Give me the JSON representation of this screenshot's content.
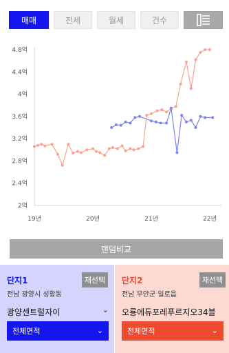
{
  "tabs": [
    {
      "label": "매매",
      "active": true
    },
    {
      "label": "전세",
      "active": false
    },
    {
      "label": "월세",
      "active": false
    },
    {
      "label": "건수",
      "active": false
    }
  ],
  "list_button_icon": "list-view-icon",
  "chart_data": {
    "type": "line",
    "ylim": [
      2.0,
      4.8
    ],
    "y_ticks": [
      "2억",
      "2.4억",
      "2.8억",
      "3.2억",
      "3.6억",
      "4억",
      "4.4억",
      "4.8억"
    ],
    "x_ticks": [
      "19년",
      "20년",
      "21년",
      "22년"
    ],
    "x_range": [
      2019.0,
      2022.2
    ],
    "grid": false,
    "series": [
      {
        "color": "#f8a493",
        "x": [
          2019.0,
          2019.06,
          2019.12,
          2019.18,
          2019.3,
          2019.4,
          2019.48,
          2019.58,
          2019.66,
          2019.74,
          2019.8,
          2019.9,
          2020.0,
          2020.06,
          2020.12,
          2020.2,
          2020.28,
          2020.34,
          2020.42,
          2020.5,
          2020.56,
          2020.64,
          2020.7,
          2020.78,
          2020.86,
          2020.92,
          2021.0,
          2021.1,
          2021.18,
          2021.26,
          2021.34,
          2021.42,
          2021.5,
          2021.6,
          2021.68,
          2021.76,
          2021.84,
          2021.92,
          2022.0
        ],
        "y": [
          3.06,
          3.08,
          3.1,
          3.07,
          3.1,
          2.92,
          2.72,
          3.1,
          2.94,
          2.97,
          2.95,
          3.0,
          3.02,
          2.97,
          2.95,
          2.9,
          3.02,
          3.04,
          3.02,
          3.07,
          2.98,
          3.02,
          3.0,
          3.02,
          3.06,
          3.62,
          3.65,
          3.7,
          3.72,
          3.68,
          3.74,
          3.78,
          4.18,
          4.58,
          4.1,
          4.62,
          4.75,
          4.8,
          4.8
        ]
      },
      {
        "color": "#7d82ee",
        "x": [
          2020.32,
          2020.4,
          2020.48,
          2020.56,
          2020.64,
          2020.72,
          2020.8,
          2021.0,
          2021.08,
          2021.16,
          2021.26,
          2021.34,
          2021.44,
          2021.52,
          2021.6,
          2021.68,
          2021.76,
          2021.84,
          2021.92,
          2022.05
        ],
        "y": [
          3.4,
          3.45,
          3.44,
          3.5,
          3.48,
          3.58,
          3.6,
          3.52,
          3.5,
          3.48,
          3.48,
          3.75,
          2.95,
          3.62,
          3.5,
          3.53,
          3.4,
          3.6,
          3.58,
          3.58
        ]
      }
    ]
  },
  "random_compare_label": "랜덤비교",
  "left_panel": {
    "title": "단지1",
    "reselect_label": "재선택",
    "address": "전남 광양시 성황동",
    "apt_name": "광양센트럴자이",
    "area_label": "전체면적",
    "accent": "#1515ef"
  },
  "right_panel": {
    "title": "단지2",
    "reselect_label": "재선택",
    "address": "전남 무안군 일로읍",
    "apt_name": "오룡에듀포레푸르지오34블",
    "area_label": "전체면적",
    "accent": "#ee4a30"
  }
}
